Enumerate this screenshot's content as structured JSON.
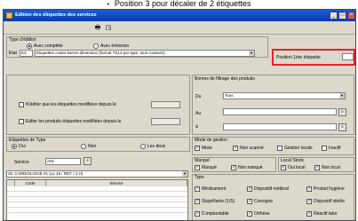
{
  "caption": {
    "bullet": "•",
    "text": "Position 3 pour décaler de 2 étiquettes"
  },
  "window": {
    "title": "Edition des étiquettes des services",
    "controls": {
      "minimize": "_",
      "maximize": "□",
      "close": "×"
    }
  },
  "toolbar": {
    "icons": [
      "printer-icon",
      "preview-icon"
    ]
  },
  "type_edition": {
    "group_label": "Type d'édition",
    "radio_complete": "Avec complète",
    "radio_emission": "Avec émission",
    "radio_complete_selected": true,
    "radio_emission_selected": false,
    "etat_label": "Etat",
    "etat_code": "E3",
    "etat_value": "Etiquettes codes barres dimension (format TS13 par type, tous couleurs)"
  },
  "position": {
    "label": "Position 1ère étiquette",
    "value": ""
  },
  "edition_options": {
    "checkbox1_label": "N'éditer que les étiquettes modifiées depuis le",
    "checkbox1_date": "",
    "checkbox2_label": "Editer les produits étiquettes modifiées depuis le",
    "checkbox2_date": ""
  },
  "borne": {
    "group_label": "Bornes de filtrage des produits",
    "row1_label": "Du",
    "row1_value": "Tous",
    "row2_label": "Au",
    "row2_value": "",
    "row3_label": "à",
    "row3_value": ""
  },
  "type_etiquette": {
    "group_label": "Etiquettes de Type",
    "options": [
      "Oui",
      "Non",
      "Les deux"
    ],
    "selected_index": 0
  },
  "service": {
    "label": "Service",
    "code": "A01",
    "list_value": "SC CARDIOLOGIE #1 (Le 18 / RDT / 2 H)"
  },
  "table": {
    "headers": [
      "Code",
      "Service"
    ],
    "rows": 5
  },
  "mode_gestion": {
    "group_label": "Mode de gestion",
    "options": [
      "Mixte",
      "Non scanné",
      "Gestion locale",
      "Inactif"
    ],
    "checked": [
      true,
      true,
      false,
      false
    ]
  },
  "marque": {
    "group_label": "Marqué",
    "options": [
      "Marqué",
      "Non marqué"
    ],
    "checked": [
      true,
      true
    ]
  },
  "local_stock": {
    "group_label": "Local Stock",
    "options": [
      "Oui local",
      "Non local"
    ],
    "checked": [
      true,
      true
    ]
  },
  "types": {
    "group_label": "Type",
    "options": [
      "Médicament",
      "Dispositif médical",
      "Produit hygiène",
      "Stupéfiants (1/S)",
      "Consigne",
      "Dispositif stérile",
      "D.implantable",
      "Orthèse",
      "Réactif labo"
    ],
    "checked": [
      true,
      true,
      true,
      true,
      true,
      true,
      true,
      true,
      true
    ]
  },
  "colors": {
    "window_bg": "#dcd8cc",
    "title_bar": "#1b5ed6",
    "highlight": "#e0232b"
  }
}
